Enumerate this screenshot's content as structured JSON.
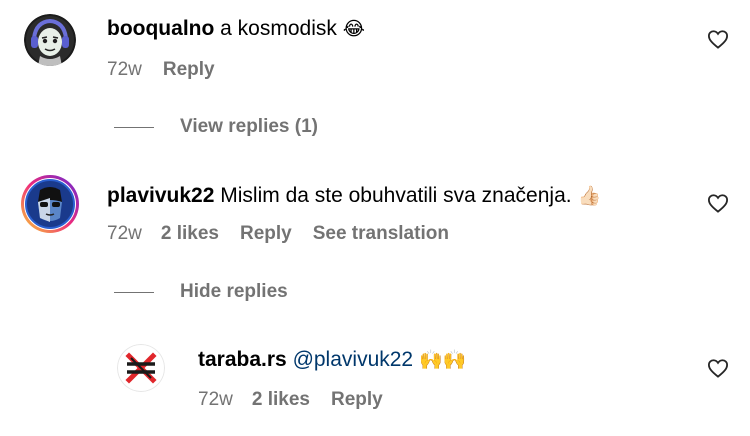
{
  "comments": [
    {
      "username": "booqualno",
      "text": "a kosmodisk",
      "emoji": "😂",
      "time": "72w",
      "reply_label": "Reply",
      "replies_toggle": "View replies (1)"
    },
    {
      "username": "plavivuk22",
      "text": "Mislim da ste obuhvatili sva značenja.",
      "emoji": "👍🏻",
      "time": "72w",
      "likes": "2 likes",
      "reply_label": "Reply",
      "translate_label": "See translation",
      "replies_toggle": "Hide replies"
    },
    {
      "username": "taraba.rs",
      "mention": "@plavivuk22",
      "emoji": "🙌🙌",
      "time": "72w",
      "likes": "2 likes",
      "reply_label": "Reply"
    }
  ],
  "colors": {
    "text": "#000000",
    "muted": "#737373",
    "mention": "#00376b"
  }
}
